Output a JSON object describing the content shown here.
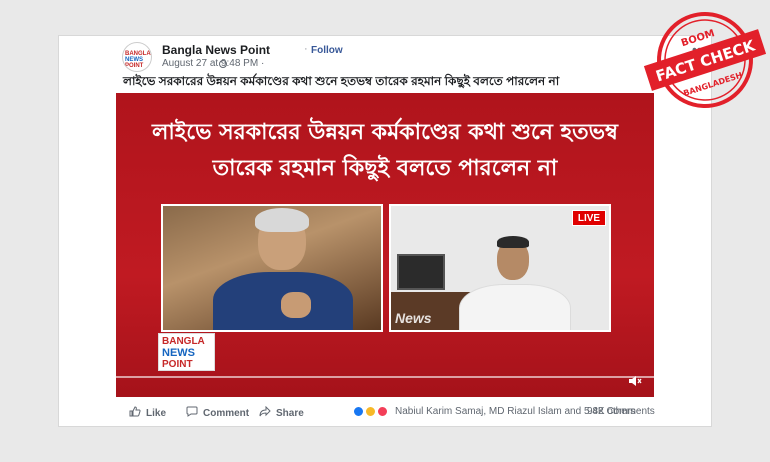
{
  "post": {
    "page_name": "Bangla News Point",
    "separator": "·",
    "follow_label": "Follow",
    "timestamp": "August 27 at 9:48 PM ·",
    "more_label": "•••",
    "text": "লাইভে সরকারের উন্নয়ন কর্মকাণ্ডের কথা শুনে হতভম্ব তারেক রহমান কিছুই বলতে পারলেন না",
    "avatar_logo": [
      "BANGLA",
      "NEWS",
      "POINT"
    ]
  },
  "video": {
    "headline_line1": "লাইভে সরকারের উন্নয়ন কর্মকাণ্ডের কথা শুনে হতভম্ব",
    "headline_line2": "তারেক রহমান কিছুই বলতে পারলেন না",
    "live_label": "LIVE",
    "watermark": "News",
    "logo_line1": "BANGLA",
    "logo_line2": "NEWS",
    "logo_line3": "POINT",
    "colors": {
      "background": "#b0141c",
      "live": "#e00000"
    }
  },
  "actions": {
    "like_label": "Like",
    "comment_label": "Comment",
    "share_label": "Share",
    "reactors": "Nabiul Karim Samaj, MD Riazul Islam and 5.4K others",
    "comments_count": "982 Comments"
  },
  "stamp": {
    "top": "BOOM",
    "middle": "FACT CHECK",
    "bottom": "BANGLADESH",
    "color": "#e2202a"
  }
}
